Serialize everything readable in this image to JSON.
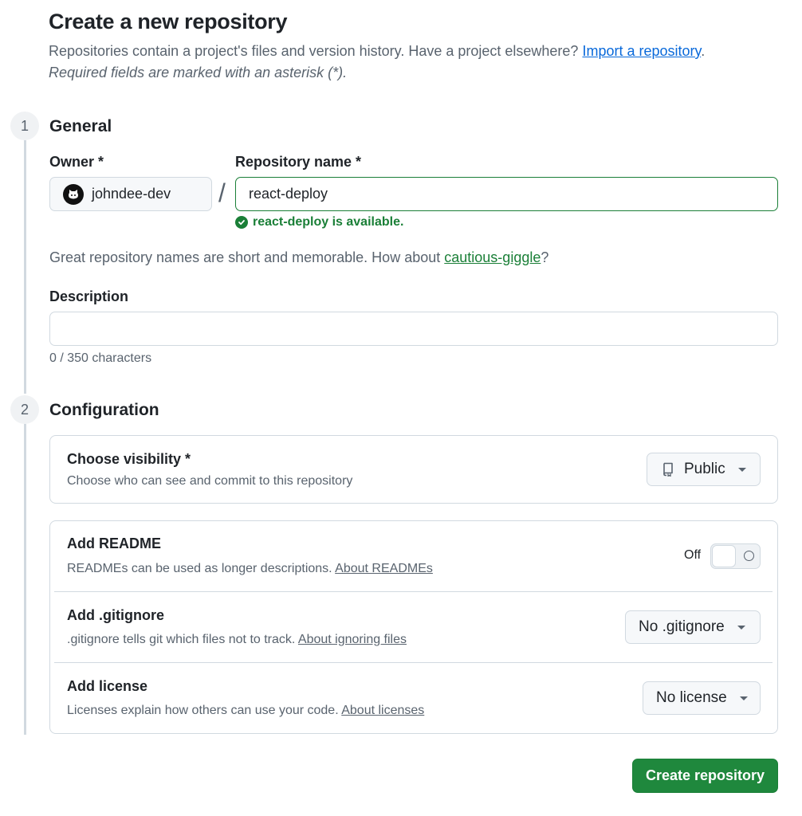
{
  "header": {
    "title": "Create a new repository",
    "subtitle": "Repositories contain a project's files and version history. Have a project elsewhere?",
    "import_link": "Import a repository",
    "import_suffix": ".",
    "required_note": "Required fields are marked with an asterisk (*)."
  },
  "general": {
    "step": "1",
    "title": "General",
    "owner_label": "Owner *",
    "owner_value": "johndee-dev",
    "slash": "/",
    "repo_label": "Repository name *",
    "repo_value": "react-deploy",
    "availability": "react-deploy is available.",
    "suggest_text": "Great repository names are short and memorable. How about",
    "suggest_link": "cautious-giggle",
    "suggest_suffix": "?",
    "description_label": "Description",
    "description_value": "",
    "char_count": "0 / 350 characters"
  },
  "configuration": {
    "step": "2",
    "title": "Configuration",
    "visibility": {
      "title": "Choose visibility *",
      "desc": "Choose who can see and commit to this repository",
      "value": "Public"
    },
    "readme": {
      "title": "Add README",
      "desc": "READMEs can be used as longer descriptions.",
      "link": "About READMEs",
      "toggle_label": "Off"
    },
    "gitignore": {
      "title": "Add .gitignore",
      "desc": ".gitignore tells git which files not to track.",
      "link": "About ignoring files",
      "value": "No .gitignore"
    },
    "license": {
      "title": "Add license",
      "desc": "Licenses explain how others can use your code.",
      "link": "About licenses",
      "value": "No license"
    }
  },
  "actions": {
    "create_label": "Create repository"
  },
  "colors": {
    "accent_green": "#1f883d",
    "link_blue": "#0969da",
    "success_green": "#1a7f37"
  }
}
